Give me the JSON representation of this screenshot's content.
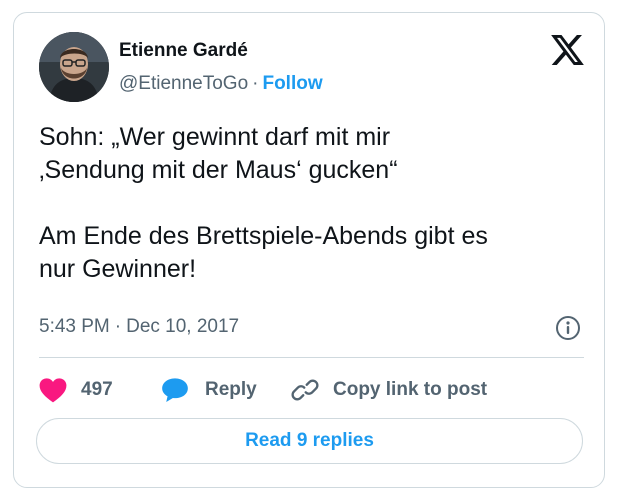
{
  "author": {
    "name": "Etienne Gardé",
    "handle": "@EtienneToGo",
    "separator": "·",
    "follow_label": "Follow"
  },
  "tweet": {
    "line1": "Sohn: „Wer gewinnt darf mit mir",
    "line2": "‚Sendung mit der Maus‘ gucken“",
    "line3": "Am Ende des Brettspiele-Abends gibt es",
    "line4": "nur Gewinner!"
  },
  "meta": {
    "time": "5:43 PM",
    "separator": "·",
    "date": "Dec 10, 2017"
  },
  "actions": {
    "like_count": "497",
    "reply_label": "Reply",
    "copy_label": "Copy link to post"
  },
  "read_replies_label": "Read 9 replies",
  "icons": {
    "logo": "x-logo-icon",
    "info": "info-icon",
    "like": "heart-icon",
    "reply": "speech-bubble-icon",
    "copy": "link-icon"
  },
  "colors": {
    "accent": "#1d9bf0",
    "like": "#f91880",
    "text": "#0f1419",
    "secondary": "#536471",
    "border": "#cfd9de"
  }
}
